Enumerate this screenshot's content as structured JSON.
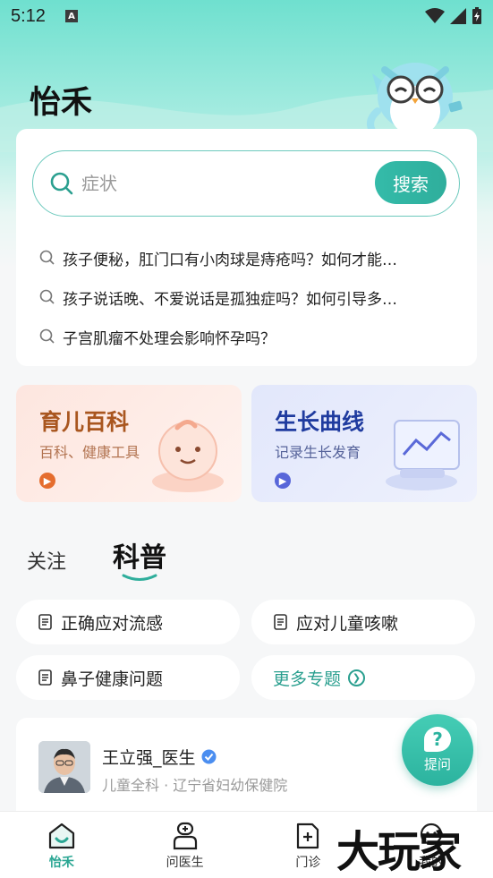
{
  "status_bar": {
    "time": "5:12",
    "app_indicator": "A"
  },
  "header": {
    "title": "怡禾"
  },
  "search": {
    "placeholder": "症状",
    "button_label": "搜索",
    "hot_questions": [
      "孩子便秘，肛门口有小肉球是痔疮吗？如何才能…",
      "孩子说话晚、不爱说话是孤独症吗？如何引导多…",
      "子宫肌瘤不处理会影响怀孕吗？"
    ]
  },
  "features": [
    {
      "title": "育儿百科",
      "subtitle": "百科、健康工具"
    },
    {
      "title": "生长曲线",
      "subtitle": "记录生长发育"
    }
  ],
  "tabs": [
    {
      "label": "关注",
      "active": false
    },
    {
      "label": "科普",
      "active": true
    }
  ],
  "topics": [
    {
      "label": "正确应对流感"
    },
    {
      "label": "应对儿童咳嗽"
    },
    {
      "label": "鼻子健康问题"
    },
    {
      "label": "更多专题"
    }
  ],
  "doctor": {
    "name": "王立强_医生",
    "info": "儿童全科 · 辽宁省妇幼保健院"
  },
  "ask_button": {
    "label": "提问"
  },
  "bottom_nav": [
    {
      "label": "怡禾",
      "icon": "home-icon",
      "active": true
    },
    {
      "label": "问医生",
      "icon": "doctor-icon",
      "active": false
    },
    {
      "label": "门诊",
      "icon": "clinic-icon",
      "active": false
    },
    {
      "label": "我的",
      "icon": "profile-icon",
      "active": false
    }
  ],
  "watermark": "大玩家",
  "colors": {
    "accent": "#2fae9c",
    "baike_title": "#a9561f",
    "growth_title": "#1f3b9f"
  }
}
